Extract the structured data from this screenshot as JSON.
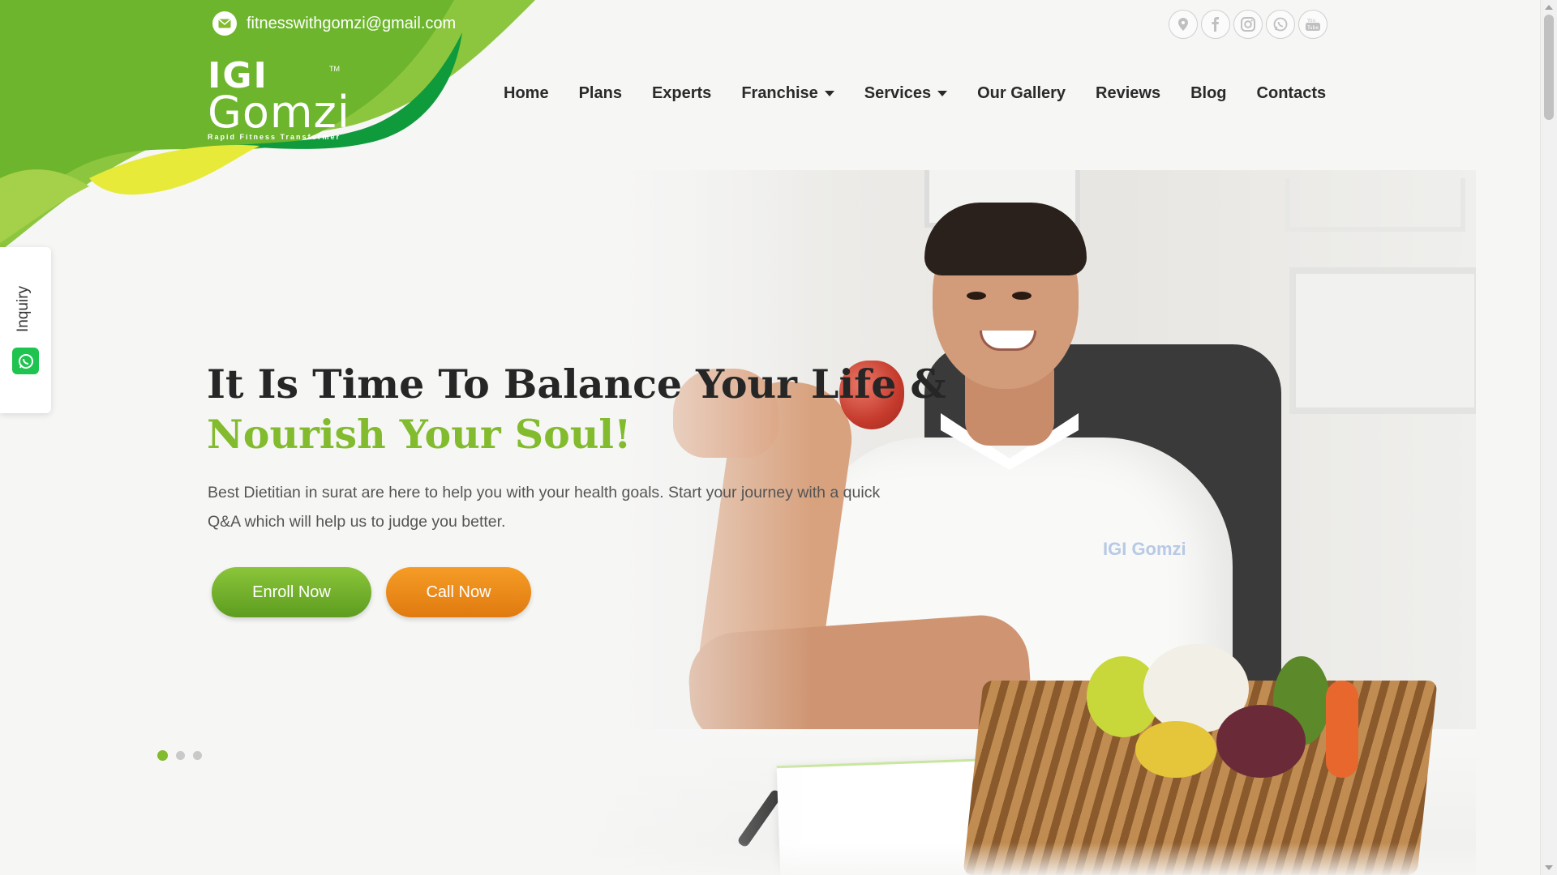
{
  "topbar": {
    "email": "fitnesswithgomzi@gmail.com",
    "social_icons": [
      "location-icon",
      "facebook-icon",
      "instagram-icon",
      "whatsapp-icon",
      "youtube-icon"
    ]
  },
  "logo": {
    "mark": "IGI",
    "word": "Gomzi",
    "tagline": "Rapid Fitness Transformer",
    "tm": "TM"
  },
  "nav": {
    "items": [
      {
        "label": "Home"
      },
      {
        "label": "Plans"
      },
      {
        "label": "Experts"
      },
      {
        "label": "Franchise",
        "dropdown": true
      },
      {
        "label": "Services",
        "dropdown": true
      },
      {
        "label": "Our Gallery"
      },
      {
        "label": "Reviews"
      },
      {
        "label": "Blog"
      },
      {
        "label": "Contacts"
      }
    ]
  },
  "inquiry": {
    "label": "Inquiry"
  },
  "hero": {
    "title_line1": "It Is Time To Balance Your Life &",
    "title_line2": "Nourish Your Soul!",
    "lead": "Best Dietitian in surat are here to help you with your health goals. Start your journey with a quick Q&A which will help us to judge you better.",
    "enroll_label": "Enroll Now",
    "call_label": "Call Now",
    "shirt_logo": "IGI Gomzi",
    "slides": 3,
    "active_slide": 1
  },
  "colors": {
    "brand_green": "#82bb2d",
    "accent_orange": "#ee8a1a",
    "dark_green": "#0f9a3c",
    "yellow": "#e8ea3a"
  }
}
